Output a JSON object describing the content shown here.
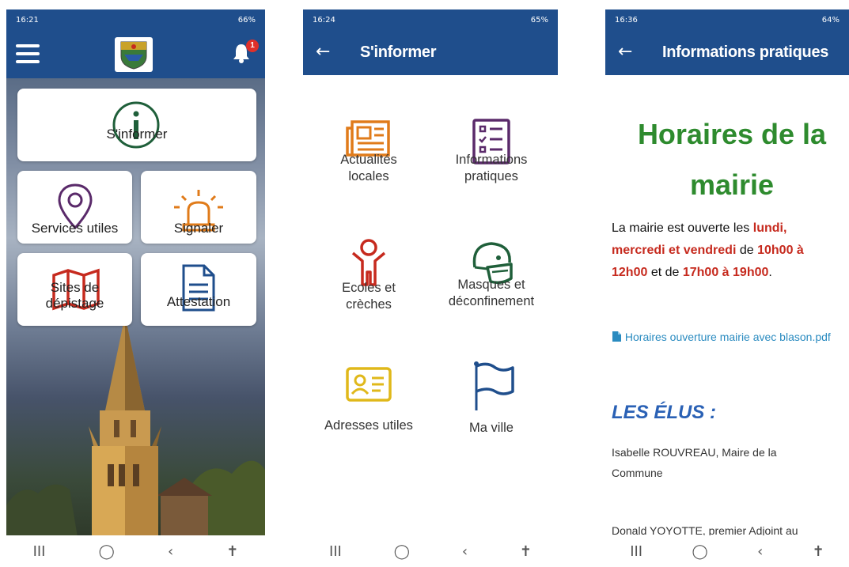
{
  "screen1": {
    "status": {
      "time": "16:21",
      "right": "66%"
    },
    "tiles": {
      "sinformer": "S'informer",
      "services": "Services utiles",
      "signaler": "Signaler",
      "sites": "Sites de dépistage",
      "attestation": "Attestation"
    },
    "notification_count": "1",
    "nav": {
      "recent": "III",
      "home": "◯",
      "back": "‹",
      "access": "✝"
    }
  },
  "screen2": {
    "status": {
      "time": "16:24",
      "right": "65%"
    },
    "title": "S'informer",
    "items": {
      "actualites": "Actualités locales",
      "infos": "Informations pratiques",
      "ecoles": "Ecoles et crèches",
      "masques": "Masques et déconfinement",
      "adresses": "Adresses utiles",
      "ville": "Ma ville"
    },
    "nav": {
      "recent": "III",
      "home": "◯",
      "back": "‹",
      "access": "✝"
    }
  },
  "screen3": {
    "status": {
      "time": "16:36",
      "right": "64%"
    },
    "title": "Informations pratiques",
    "heading_line1": "Horaires de la",
    "heading_line2": "mairie",
    "para": {
      "t1": "La mairie est ouverte les ",
      "r1": "lundi,",
      "r2": "mercredi et vendredi",
      "t2": " de ",
      "r3": "10h00 à",
      "r4": "12h00",
      "t3": " et de ",
      "r5": "17h00 à 19h00",
      "t4": "."
    },
    "link": "Horaires ouverture mairie avec blason.pdf",
    "elus_title": "LES ÉLUS :",
    "elu1": "Isabelle ROUVREAU, Maire de la Commune",
    "elu2": "Donald YOYOTTE, premier Adjoint au",
    "nav": {
      "recent": "III",
      "home": "◯",
      "back": "‹",
      "access": "✝"
    }
  },
  "colors": {
    "appbar": "#1f4e8c",
    "green": "#2e8b2e",
    "red": "#c62a1e",
    "link": "#2a8bc0",
    "elus": "#2a61b5"
  },
  "icons": [
    "info-icon",
    "map-pin-icon",
    "siren-icon",
    "map-icon",
    "document-icon",
    "newspaper-icon",
    "checklist-icon",
    "child-icon",
    "mask-icon",
    "contact-card-icon",
    "flag-icon",
    "menu-icon",
    "bell-icon",
    "back-arrow-icon",
    "file-icon"
  ]
}
